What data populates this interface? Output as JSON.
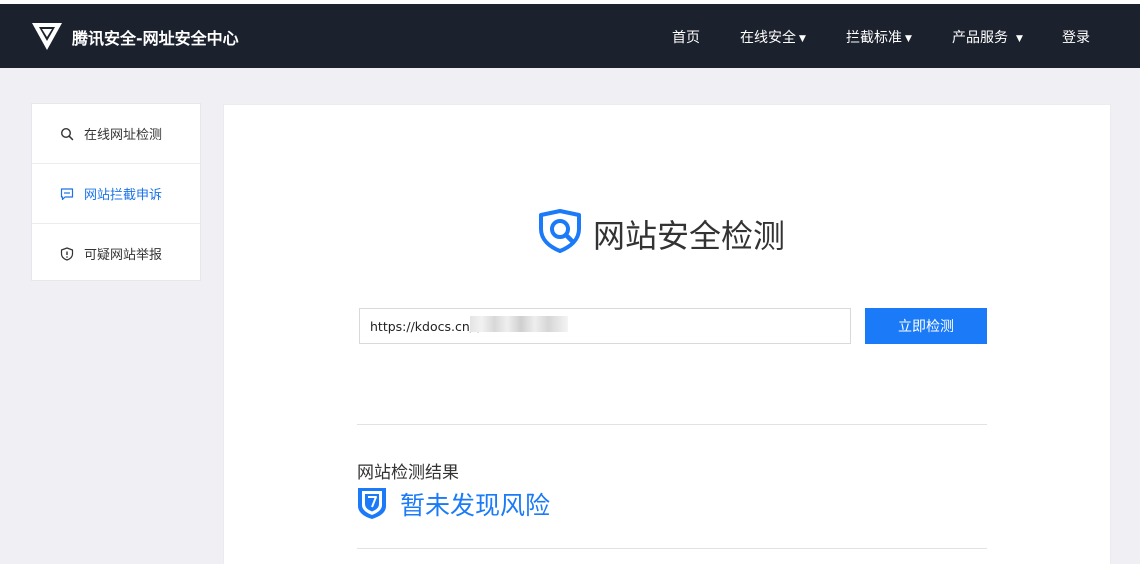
{
  "header": {
    "logo_icon": "tencent-security-logo-icon",
    "site_title": "腾讯安全-网址安全中心",
    "nav": [
      {
        "label": "首页"
      },
      {
        "label": "在线安全",
        "caret": "▼"
      },
      {
        "label": "拦截标准",
        "caret": "▼"
      },
      {
        "label": "产品服务",
        "caret": "▼"
      },
      {
        "label": "登录"
      }
    ]
  },
  "sidebar": {
    "items": [
      {
        "label": "在线网址检测",
        "icon": "search-icon"
      },
      {
        "label": "网站拦截申诉",
        "icon": "chat-bubble-icon",
        "active": true
      },
      {
        "label": "可疑网站举报",
        "icon": "shield-alert-icon"
      }
    ]
  },
  "main": {
    "title": "网站安全检测",
    "title_icon": "shield-search-icon",
    "url_value": "https://kdocs.cn/l/",
    "check_button": "立即检测",
    "result_label": "网站检测结果",
    "result_icon": "shield-check-icon",
    "result_text": "暂未发现风险"
  },
  "colors": {
    "navbar_bg": "#1c212e",
    "accent": "#1a7af8",
    "page_bg": "#f0f0f4"
  }
}
